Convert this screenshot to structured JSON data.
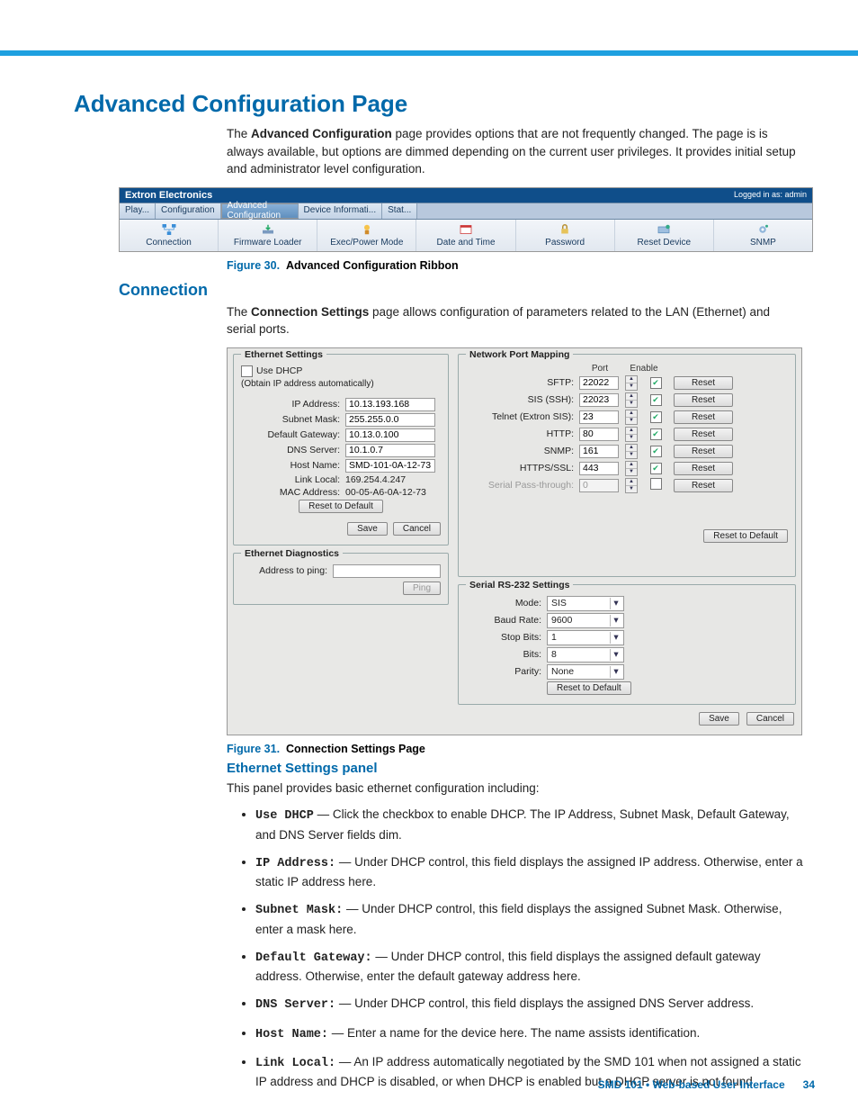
{
  "headings": {
    "h1": "Advanced Configuration Page",
    "h2_connection": "Connection",
    "h3_ethsettings": "Ethernet Settings panel"
  },
  "intro1": "The ",
  "intro1b": "Advanced Configuration",
  "intro1c": " page provides options that are not frequently changed. The page is is always available, but options are dimmed depending on the current user privileges. It provides initial setup and administrator level configuration.",
  "intro2": "The ",
  "intro2b": "Connection Settings",
  "intro2c": " page allows configuration of parameters related to the LAN (Ethernet) and serial ports.",
  "fig30_a": "Figure 30.",
  "fig30_b": "Advanced Configuration Ribbon",
  "fig31_a": "Figure 31.",
  "fig31_b": "Connection Settings Page",
  "eth_intro": "This panel provides basic ethernet configuration including:",
  "ribbon": {
    "brand": "Extron Electronics",
    "login": "Logged in as: admin",
    "tabs": [
      "Play...",
      "Configuration",
      "Advanced Configuration",
      "Device Informati...",
      "Stat..."
    ],
    "icons": [
      "Connection",
      "Firmware Loader",
      "Exec/Power Mode",
      "Date and Time",
      "Password",
      "Reset Device",
      "SNMP"
    ]
  },
  "panel": {
    "eth": {
      "title": "Ethernet Settings",
      "dhcp_label": "Use DHCP",
      "dhcp_sub": "(Obtain IP address automatically)",
      "fields": {
        "ip_lbl": "IP Address:",
        "ip": "10.13.193.168",
        "sn_lbl": "Subnet Mask:",
        "sn": "255.255.0.0",
        "gw_lbl": "Default Gateway:",
        "gw": "10.13.0.100",
        "dns_lbl": "DNS Server:",
        "dns": "10.1.0.7",
        "host_lbl": "Host Name:",
        "host": "SMD-101-0A-12-73",
        "ll_lbl": "Link Local:",
        "ll": "169.254.4.247",
        "mac_lbl": "MAC Address:",
        "mac": "00-05-A6-0A-12-73"
      },
      "reset": "Reset to Default",
      "save": "Save",
      "cancel": "Cancel"
    },
    "diag": {
      "title": "Ethernet Diagnostics",
      "addr_lbl": "Address to ping:",
      "ping": "Ping"
    },
    "ports": {
      "title": "Network Port Mapping",
      "col_port": "Port",
      "col_enable": "Enable",
      "rows": [
        {
          "lbl": "SFTP:",
          "port": "22022",
          "en": true,
          "reset": "Reset"
        },
        {
          "lbl": "SIS (SSH):",
          "port": "22023",
          "en": true,
          "reset": "Reset"
        },
        {
          "lbl": "Telnet (Extron SIS):",
          "port": "23",
          "en": true,
          "reset": "Reset"
        },
        {
          "lbl": "HTTP:",
          "port": "80",
          "en": true,
          "reset": "Reset"
        },
        {
          "lbl": "SNMP:",
          "port": "161",
          "en": true,
          "reset": "Reset"
        },
        {
          "lbl": "HTTPS/SSL:",
          "port": "443",
          "en": true,
          "reset": "Reset"
        },
        {
          "lbl": "Serial Pass-through:",
          "port": "0",
          "en": false,
          "reset": "Reset",
          "disabled": true
        }
      ],
      "reset_all": "Reset to Default"
    },
    "serial": {
      "title": "Serial RS-232 Settings",
      "mode_lbl": "Mode:",
      "mode": "SIS",
      "baud_lbl": "Baud Rate:",
      "baud": "9600",
      "stop_lbl": "Stop Bits:",
      "stop": "1",
      "bits_lbl": "Bits:",
      "bits": "8",
      "parity_lbl": "Parity:",
      "parity": "None",
      "reset": "Reset to Default"
    },
    "bottom": {
      "save": "Save",
      "cancel": "Cancel"
    }
  },
  "bullets": [
    {
      "t": "Use DHCP",
      "d": " — Click the checkbox to enable DHCP. The IP Address, Subnet Mask, Default Gateway, and DNS Server fields dim."
    },
    {
      "t": "IP Address:",
      "d": " — Under DHCP control, this field displays the assigned IP address. Otherwise, enter a static IP address here."
    },
    {
      "t": "Subnet Mask:",
      "d": " — Under DHCP control, this field displays the assigned Subnet Mask. Otherwise, enter a mask here."
    },
    {
      "t": "Default Gateway:",
      "d": " — Under DHCP control, this field displays the assigned default gateway address. Otherwise, enter the default gateway address here."
    },
    {
      "t": "DNS Server:",
      "d": " — Under DHCP control, this field displays the assigned DNS Server address."
    },
    {
      "t": "Host Name:",
      "d": " — Enter a name for the device here. The name assists identification."
    },
    {
      "t": "Link Local:",
      "d": " — An IP address automatically negotiated by the SMD 101 when not assigned a static IP address and DHCP is disabled, or when DHCP is enabled but a DHCP server is not found."
    }
  ],
  "footer": {
    "title": "SMD 101 • Web-based User Interface",
    "page": "34"
  }
}
